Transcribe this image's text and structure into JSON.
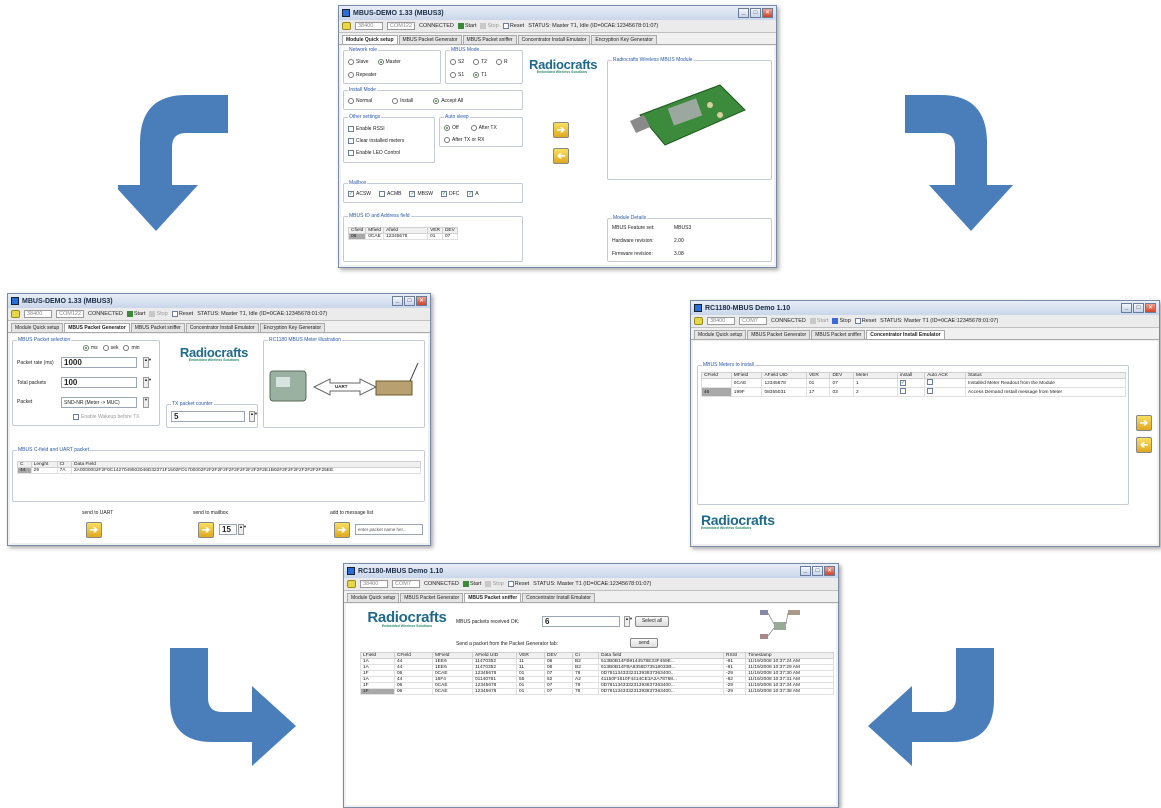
{
  "windows": {
    "top": {
      "title": "MBUS-DEMO 1.33 (MBUS3)",
      "toolbar": {
        "baud": "38400",
        "port": "COM122",
        "status": "CONNECTED",
        "start": "Start",
        "stop": "Stop",
        "reset": "Reset",
        "status_text": "STATUS: Master T1, Idle  (ID=0CAE:12345678:01:07)"
      },
      "tabs": [
        "Module Quick setup",
        "MBUS Packet Generator",
        "MBUS Packet sniffer",
        "Concentrator Install Emulator",
        "Encryption Key Generator"
      ],
      "network_role": {
        "label": "Network role",
        "options": [
          "Slave",
          "Master",
          "Repeater"
        ]
      },
      "mbus_mode": {
        "label": "MBUS Mode",
        "options": [
          "S2",
          "T2",
          "R",
          "S1",
          "T1"
        ]
      },
      "install_mode": {
        "label": "Install Mode",
        "options": [
          "Normal",
          "Install",
          "Accept All"
        ]
      },
      "other_settings": {
        "label": "Other settings",
        "options": [
          "Enable RSSI",
          "Clear installed meters",
          "Enable LED Control"
        ]
      },
      "auto_sleep": {
        "label": "Auto sleep",
        "options": [
          "Off",
          "After TX",
          "After TX or RX"
        ]
      },
      "mailbox": {
        "label": "Mailbox",
        "options": [
          "ACSW",
          "ACMB",
          "MBSW",
          "DFC",
          "A"
        ]
      },
      "id_field": {
        "label": "MBUS ID and Address field",
        "headers": [
          "Cfield",
          "Mfield",
          "Afield",
          "VER",
          "DEV"
        ],
        "row": [
          "06",
          "0CAE",
          "12345678",
          "01",
          "07"
        ]
      },
      "module_label": "Radiocrafts Wireless MBUS Module",
      "details": {
        "label": "Module Details",
        "rows": [
          [
            "MBUS Feature set:",
            "MBUS3"
          ],
          [
            "Hardware revision:",
            "2.00"
          ],
          [
            "Firmware revision:",
            "3.08"
          ]
        ]
      }
    },
    "left": {
      "title": "MBUS-DEMO 1.33 (MBUS3)",
      "toolbar": {
        "baud": "38400",
        "port": "COM122",
        "status": "CONNECTED",
        "start": "Start",
        "stop": "Stop",
        "reset": "Reset",
        "status_text": "STATUS: Master T1, Idle  (ID=0CAE:12345678:01:07)"
      },
      "tabs": [
        "Module Quick setup",
        "MBUS Packet Generator",
        "MBUS Packet sniffer",
        "Concentrator Install Emulator",
        "Encryption Key Generator"
      ],
      "selection_label": "MBUS Packet selection",
      "units": [
        "ms",
        "sek",
        "min"
      ],
      "packet_rate_label": "Packet rate (ms)",
      "packet_rate": "1000",
      "total_label": "Total packets",
      "total": "100",
      "packet_label": "Packet",
      "packet": "SND-NR (Meter -> MUC)",
      "wakeup": "Enable Wakeup before TX",
      "counter_label": "TX packet counter",
      "counter": "5",
      "meter_label": "RC1180 MBUS Meter illustration",
      "uart_tag": "UART",
      "cfield_label": "MBUS C-field and UART packet",
      "packet_headers": [
        "C",
        "Lenght",
        "CI",
        "Data Field"
      ],
      "packet_row": [
        "44",
        "29",
        "7A",
        "2A0000002F2F0C1427049502046D32371F1502FD1700002F2F2F2F2F2F2F2F2F2F2F2E1B02F2F2F2F2F2F2F2F25EE"
      ],
      "send_uart": "send to UART",
      "send_mailbox": "send to mailbox",
      "mailbox_val": "15",
      "add_list": "add to message list",
      "name_placeholder": "enter packet name her..."
    },
    "right": {
      "title": "RC1180-MBUS Demo 1.10",
      "toolbar": {
        "baud": "38400",
        "port": "COM7",
        "status": "CONNECTED",
        "start": "Start",
        "stop": "Stop",
        "reset": "Reset",
        "status_text": "STATUS: Master T1  (ID=0CAE:12345678:01:07)"
      },
      "tabs": [
        "Module Quick setup",
        "MBUS Packet Generator",
        "MBUS Packet sniffer",
        "Concentrator Install Emulator"
      ],
      "group_label": "MBUS Meters to install",
      "headers": [
        "CField",
        "MField",
        "AField UID",
        "VER",
        "DEV",
        "Meter",
        "install",
        "Auto ACK",
        "Status"
      ],
      "rows": [
        [
          "",
          "0CAE",
          "12345678",
          "01",
          "07",
          "1",
          "x",
          "",
          "Installed Meter Readout from the Module"
        ],
        [
          "46",
          "199F",
          "08355031",
          "17",
          "03",
          "2",
          "",
          "",
          "Access Demand Install message from Meter"
        ]
      ]
    },
    "bottom": {
      "title": "RC1180-MBUS Demo 1.10",
      "toolbar": {
        "baud": "38400",
        "port": "COM7",
        "status": "CONNECTED",
        "start": "Start",
        "stop": "Stop",
        "reset": "Reset",
        "status_text": "STATUS: Master T1  (ID=0CAE:12345678:01:07)"
      },
      "tabs": [
        "Module Quick setup",
        "MBUS Packet Generator",
        "MBUS Packet sniffer",
        "Concentrator Install Emulator"
      ],
      "received_label": "MBUS packets received OK:",
      "received": "6",
      "select_all": "Select all",
      "send_label": "Send a packet from the Packet Generator tab:",
      "send": "send",
      "headers": [
        "LField",
        "CField",
        "MField",
        "AField UID",
        "VER",
        "DEV",
        "CI",
        "Data field",
        "RSSI",
        "Timestamp"
      ],
      "rows": [
        [
          "1A",
          "44",
          "1EE6",
          "11470352",
          "11",
          "08",
          "B2",
          "513B0B14FB9144578E33F459E...",
          "-81",
          "11/19/2008 10:37:24 AM"
        ],
        [
          "1A",
          "44",
          "1EE6",
          "11470352",
          "11",
          "08",
          "B2",
          "613B0B14FBA8356D73518033B...",
          "-81",
          "11/19/2008 10:37:29 AM"
        ],
        [
          "1F",
          "06",
          "0CAE",
          "12345678",
          "01",
          "07",
          "78",
          "0D781134333231393837363400...",
          "-29",
          "11/19/2008 10:37:30 AM"
        ],
        [
          "1A",
          "44",
          "16F4",
          "01140781",
          "55",
          "62",
          "A2",
          "41150F1610F4414CE3A2A78788...",
          "-82",
          "11/19/2008 10:37:31 AM"
        ],
        [
          "1F",
          "06",
          "0CAE",
          "12345678",
          "01",
          "07",
          "78",
          "0D781134333231393837363400...",
          "-29",
          "11/19/2008 10:37:34 AM"
        ],
        [
          "1F",
          "06",
          "0CAE",
          "12345678",
          "01",
          "07",
          "78",
          "0D781134333231393837363400...",
          "-29",
          "11/19/2008 10:37:38 AM"
        ]
      ]
    }
  },
  "logo": {
    "name": "Radiocrafts",
    "tagline": "Embedded Wireless Solutions"
  },
  "colors": {
    "arrow": "#4a7ebb",
    "title_bar": "#c9d6ea",
    "logo": "#1f6a8a"
  }
}
